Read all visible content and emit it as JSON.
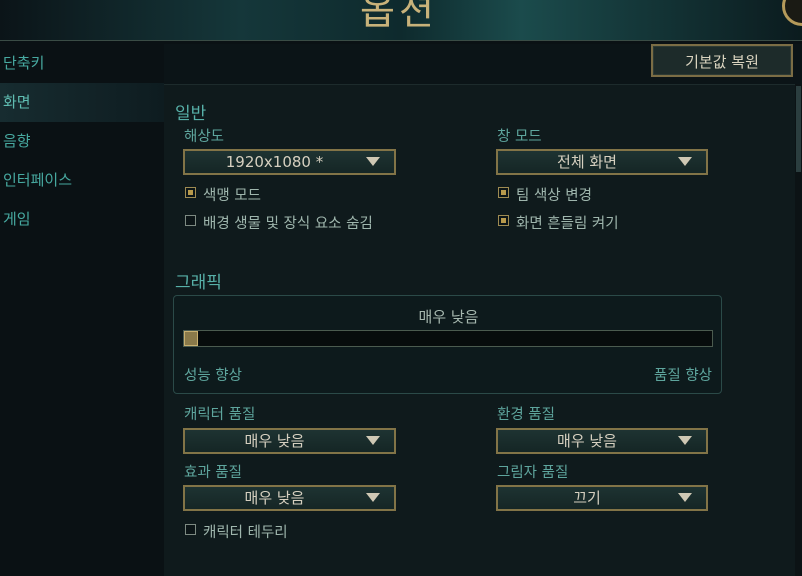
{
  "header": {
    "title": "옵션"
  },
  "sidebar": {
    "items": [
      {
        "label": "단축키"
      },
      {
        "label": "화면"
      },
      {
        "label": "음향"
      },
      {
        "label": "인터페이스"
      },
      {
        "label": "게임"
      }
    ],
    "active": "화면"
  },
  "toolbar": {
    "reset_label": "기본값 복원"
  },
  "general": {
    "title": "일반",
    "resolution": {
      "label": "해상도",
      "value": "1920x1080 *"
    },
    "window_mode": {
      "label": "창 모드",
      "value": "전체 화면"
    },
    "colorblind": {
      "label": "색맹 모드",
      "checked": true
    },
    "team_color": {
      "label": "팀 색상 변경",
      "checked": true
    },
    "hide_eye_candy": {
      "label": "배경 생물 및 장식 요소 숨김",
      "checked": false
    },
    "screen_shake": {
      "label": "화면 흔들림 켜기",
      "checked": true
    }
  },
  "graphics": {
    "title": "그래픽",
    "level_label": "매우 낮음",
    "level_fraction": 0,
    "left_caption": "성능 향상",
    "right_caption": "품질 향상",
    "character_quality": {
      "label": "캐릭터 품질",
      "value": "매우 낮음"
    },
    "environment_quality": {
      "label": "환경 품질",
      "value": "매우 낮음"
    },
    "effects_quality": {
      "label": "효과 품질",
      "value": "매우 낮음"
    },
    "shadow_quality": {
      "label": "그림자 품질",
      "value": "끄기"
    },
    "character_inking": {
      "label": "캐릭터 테두리",
      "checked": false
    }
  },
  "colors": {
    "accent_gold": "#827447",
    "accent_teal": "#57b0a8"
  }
}
